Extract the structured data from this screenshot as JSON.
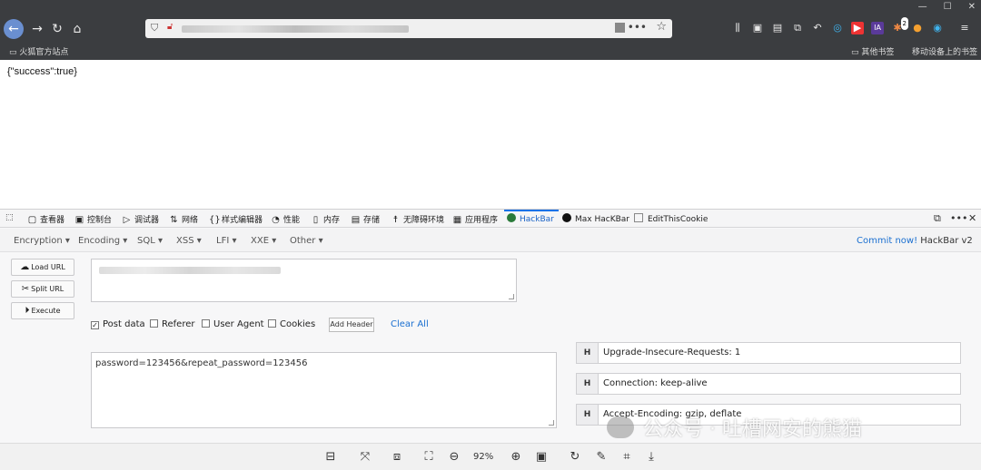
{
  "browser": {
    "bookmark_left": "火狐官方站点",
    "bookmark_right_1": "其他书签",
    "bookmark_right_2": "移动设备上的书签",
    "badge_count": "2"
  },
  "page": {
    "response_text": "{\"success\":true}"
  },
  "devtools": {
    "tabs": [
      {
        "icon": "inspector-icon",
        "label": "查看器"
      },
      {
        "icon": "console-icon",
        "label": "控制台"
      },
      {
        "icon": "debugger-icon",
        "label": "调试器"
      },
      {
        "icon": "network-icon",
        "label": "网络"
      },
      {
        "icon": "style-editor-icon",
        "label": "样式编辑器"
      },
      {
        "icon": "performance-icon",
        "label": "性能"
      },
      {
        "icon": "memory-icon",
        "label": "内存"
      },
      {
        "icon": "storage-icon",
        "label": "存储"
      },
      {
        "icon": "accessibility-icon",
        "label": "无障碍环境"
      },
      {
        "icon": "application-icon",
        "label": "应用程序"
      },
      {
        "icon": "hackbar-icon",
        "label": "HackBar"
      },
      {
        "icon": "max-hackbar-icon",
        "label": "Max HacKBar"
      },
      {
        "icon": "editthiscookie-icon",
        "label": "EditThisCookie"
      }
    ]
  },
  "hackbar": {
    "menu": [
      "Encryption ▾",
      "Encoding ▾",
      "SQL ▾",
      "XSS ▾",
      "LFI ▾",
      "XXE ▾",
      "Other ▾"
    ],
    "commit_link": "Commit now!",
    "commit_suffix": " HackBar v2",
    "load_url": "Load URL",
    "split_url": "Split URL",
    "execute": "Execute",
    "post_data_label": "Post data",
    "referer_label": "Referer",
    "user_agent_label": "User Agent",
    "cookies_label": "Cookies",
    "add_header": "Add Header",
    "clear_all": "Clear All",
    "post_body": "password=123456&repeat_password=123456",
    "post_data_checked": true,
    "headers": [
      {
        "key": "H",
        "value": "Upgrade-Insecure-Requests: 1"
      },
      {
        "key": "H",
        "value": "Connection: keep-alive"
      },
      {
        "key": "H",
        "value": "Accept-Encoding: gzip, deflate"
      }
    ]
  },
  "watermark": {
    "text": "公众号 · 吐槽网安的熊猫"
  },
  "viewer": {
    "zoom": "92%"
  }
}
